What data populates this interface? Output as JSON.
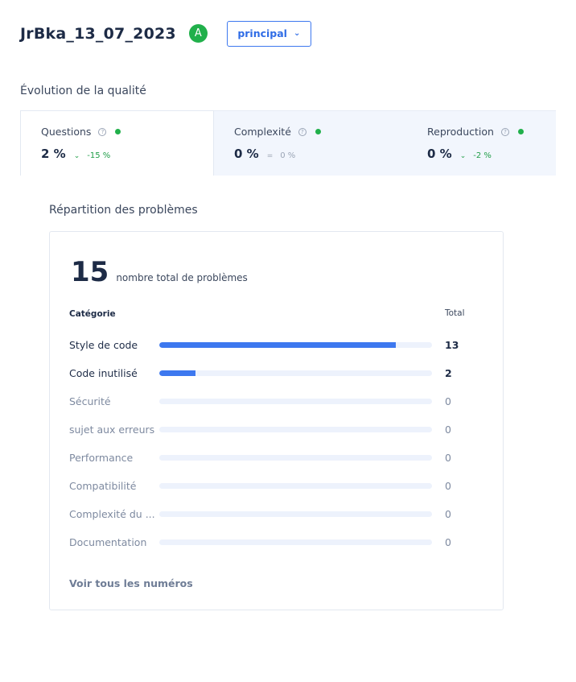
{
  "header": {
    "repo_name": "JrBka_13_07_2023",
    "grade": "A",
    "branch": "principal"
  },
  "quality": {
    "title": "Évolution de la qualité",
    "metrics": [
      {
        "label": "Questions",
        "value": "2 %",
        "trend": "⌄",
        "delta": "-15 %"
      },
      {
        "label": "Complexité",
        "value": "0 %",
        "trend": "=",
        "delta": "0 %"
      },
      {
        "label": "Reproduction",
        "value": "0 %",
        "trend": "⌄",
        "delta": "-2 %"
      }
    ]
  },
  "issues": {
    "title": "Répartition des problèmes",
    "total": "15",
    "total_label": "nombre total de problèmes",
    "col_category": "Catégorie",
    "col_total": "Total",
    "view_all": "Voir tous les numéros",
    "max": 15,
    "rows": [
      {
        "label": "Style de code",
        "count": 13
      },
      {
        "label": "Code inutilisé",
        "count": 2
      },
      {
        "label": "Sécurité",
        "count": 0
      },
      {
        "label": "sujet aux erreurs",
        "count": 0
      },
      {
        "label": "Performance",
        "count": 0
      },
      {
        "label": "Compatibilité",
        "count": 0
      },
      {
        "label": "Complexité du ...",
        "count": 0
      },
      {
        "label": "Documentation",
        "count": 0
      }
    ]
  },
  "colors": {
    "accent": "#3d78ef",
    "success": "#21b04b",
    "track": "#edf2fc"
  }
}
